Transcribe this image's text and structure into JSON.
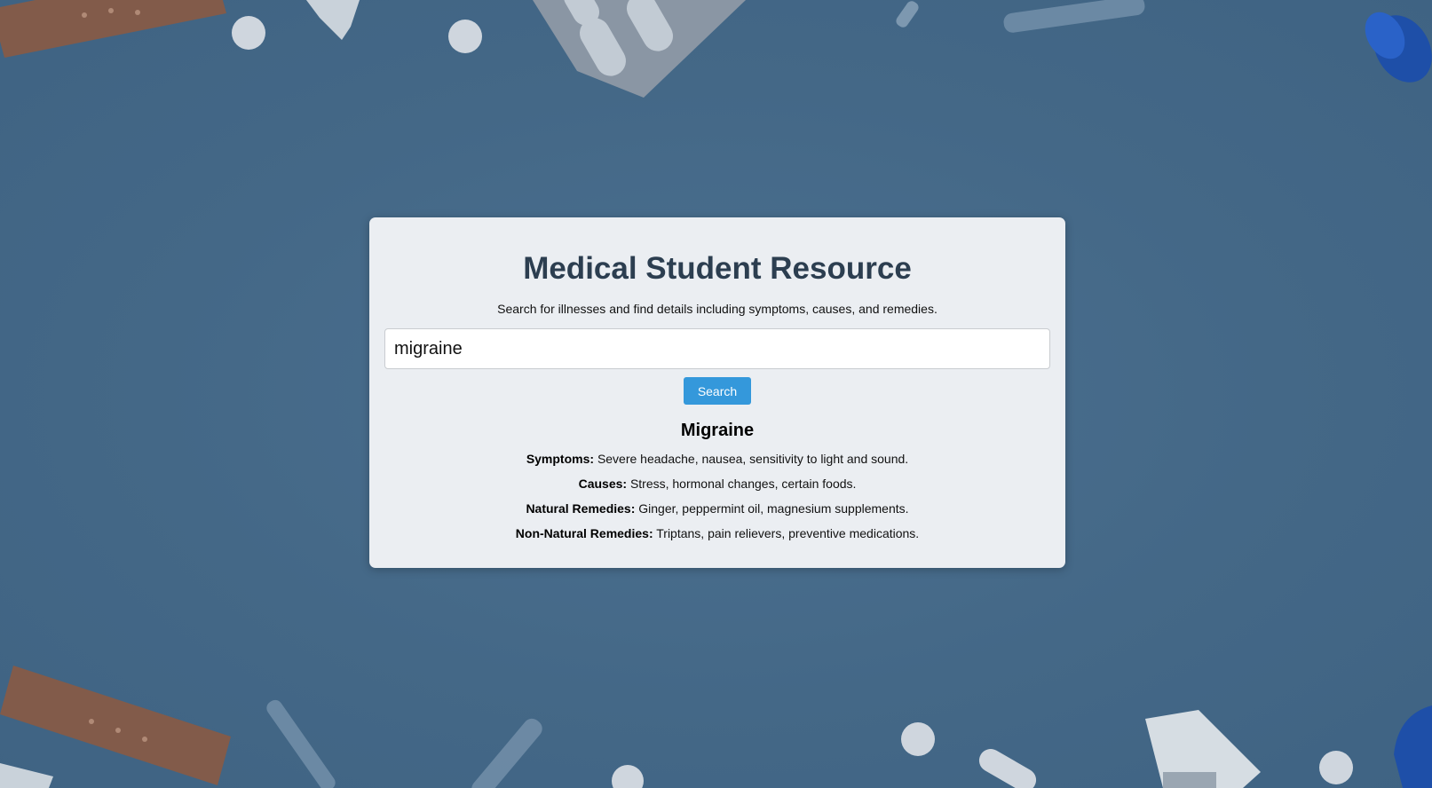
{
  "page": {
    "title": "Medical Student Resource",
    "subtitle": "Search for illnesses and find details including symptoms, causes, and remedies."
  },
  "search": {
    "value": "migraine",
    "placeholder": "",
    "button_label": "Search"
  },
  "result": {
    "name": "Migraine",
    "fields": [
      {
        "label": "Symptoms:",
        "value": "Severe headache, nausea, sensitivity to light and sound."
      },
      {
        "label": "Causes:",
        "value": "Stress, hormonal changes, certain foods."
      },
      {
        "label": "Natural Remedies:",
        "value": "Ginger, peppermint oil, magnesium supplements."
      },
      {
        "label": "Non-Natural Remedies:",
        "value": "Triptans, pain relievers, preventive medications."
      }
    ]
  },
  "colors": {
    "background": "#456a8a",
    "card": "#ebeef2",
    "title": "#2c3e50",
    "button": "#3498db"
  },
  "background_image": {
    "description_icons": [
      "bandage-icon",
      "pill-icon",
      "blister-pack-icon",
      "ampoule-icon",
      "vial-icon",
      "spray-bottle-icon"
    ]
  }
}
